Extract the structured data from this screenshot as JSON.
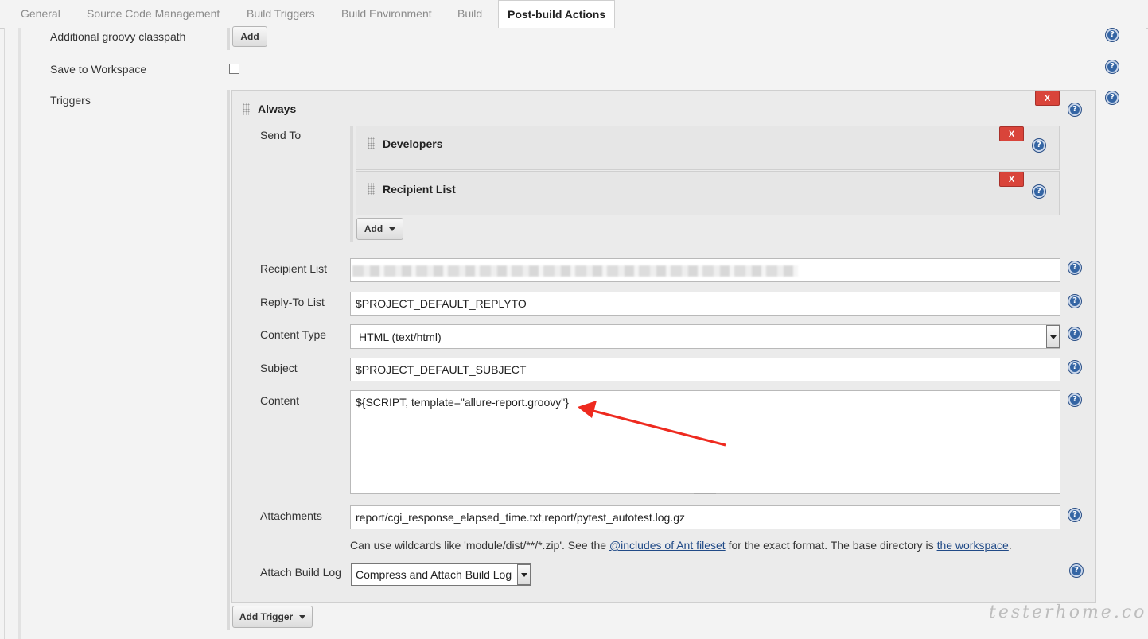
{
  "tabs": [
    "General",
    "Source Code Management",
    "Build Triggers",
    "Build Environment",
    "Build",
    "Post-build Actions"
  ],
  "active_tab": "Post-build Actions",
  "groovy_classpath": {
    "label": "Additional groovy classpath",
    "add_label": "Add"
  },
  "save_workspace": {
    "label": "Save to Workspace",
    "checked": false
  },
  "triggers": {
    "label": "Triggers",
    "always": {
      "title": "Always",
      "remove_label": "X",
      "send_to": {
        "label": "Send To",
        "items": [
          {
            "title": "Developers",
            "remove_label": "X"
          },
          {
            "title": "Recipient List",
            "remove_label": "X"
          }
        ],
        "add_label": "Add"
      },
      "recipient_list": {
        "label": "Recipient List",
        "value": ""
      },
      "reply_to": {
        "label": "Reply-To List",
        "value": "$PROJECT_DEFAULT_REPLYTO"
      },
      "content_type": {
        "label": "Content Type",
        "value": "HTML (text/html)"
      },
      "subject": {
        "label": "Subject",
        "value": "$PROJECT_DEFAULT_SUBJECT"
      },
      "content": {
        "label": "Content",
        "value": "${SCRIPT, template=\"allure-report.groovy\"}"
      },
      "attachments": {
        "label": "Attachments",
        "value": "report/cgi_response_elapsed_time.txt,report/pytest_autotest.log.gz",
        "hint_prefix": "Can use wildcards like 'module/dist/**/*.zip'. See the ",
        "hint_link1": "@includes of Ant fileset",
        "hint_middle": " for the exact format. The base directory is ",
        "hint_link2": "the workspace",
        "hint_suffix": "."
      },
      "attach_build_log": {
        "label": "Attach Build Log",
        "value": "Compress and Attach Build Log"
      }
    },
    "add_trigger_label": "Add Trigger"
  },
  "watermark": "testerhome.com",
  "colors": {
    "accent": "#3465a4",
    "remove": "#d9443a",
    "arrow": "#ee2a1f"
  }
}
